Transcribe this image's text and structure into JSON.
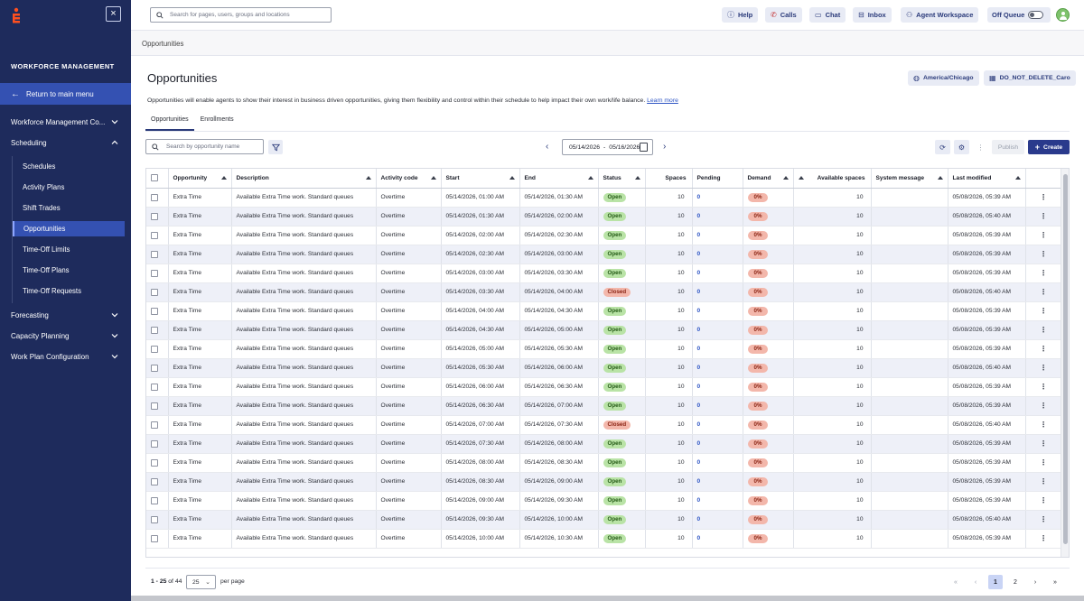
{
  "sidebar": {
    "brand_color": "#1e2b5c",
    "accent_color": "#3451b2",
    "title": "WORKFORCE MANAGEMENT",
    "return_label": "Return to main menu",
    "sections": {
      "wfm_config": "Workforce Management Co...",
      "scheduling": "Scheduling",
      "forecasting": "Forecasting",
      "capacity": "Capacity Planning",
      "work_plan": "Work Plan Configuration"
    },
    "scheduling_items": {
      "schedules": "Schedules",
      "activity_plans": "Activity Plans",
      "shift_trades": "Shift Trades",
      "opportunities": "Opportunities",
      "time_off_limits": "Time-Off Limits",
      "time_off_plans": "Time-Off Plans",
      "time_off_requests": "Time-Off Requests"
    }
  },
  "topbar": {
    "search_placeholder": "Search for pages, users, groups and locations",
    "help": "Help",
    "calls": "Calls",
    "chat": "Chat",
    "inbox": "Inbox",
    "agent_workspace": "Agent Workspace",
    "off_queue": "Off Queue"
  },
  "breadcrumb": "Opportunities",
  "page": {
    "title": "Opportunities",
    "timezone": "America/Chicago",
    "business_unit": "DO_NOT_DELETE_Caro",
    "description": "Opportunities will enable agents to show their interest in business driven opportunities, giving them flexibility and control within their schedule to help impact their own work/life balance.",
    "learn_more": "Learn more",
    "tabs": {
      "opportunities": "Opportunities",
      "enrollments": "Enrollments"
    },
    "search_placeholder": "Search by opportunity name",
    "date_start": "05/14/2026",
    "date_sep": "-",
    "date_end": "05/16/2026",
    "publish": "Publish",
    "create": "Create"
  },
  "table": {
    "columns": {
      "opportunity": "Opportunity",
      "description": "Description",
      "activity_code": "Activity code",
      "start": "Start",
      "end": "End",
      "status": "Status",
      "spaces": "Spaces",
      "pending": "Pending",
      "demand": "Demand",
      "available_spaces": "Available spaces",
      "system_message": "System message",
      "last_modified": "Last modified"
    },
    "rows": [
      {
        "opportunity": "Extra Time",
        "description": "Available Extra Time work. Standard queues",
        "activity": "Overtime",
        "start": "05/14/2026, 01:00 AM",
        "end": "05/14/2026, 01:30 AM",
        "status": "Open",
        "spaces": "10",
        "pending": "0",
        "demand": "0%",
        "available": "10",
        "message": "",
        "modified": "05/08/2026, 05:39 AM"
      },
      {
        "opportunity": "Extra Time",
        "description": "Available Extra Time work. Standard queues",
        "activity": "Overtime",
        "start": "05/14/2026, 01:30 AM",
        "end": "05/14/2026, 02:00 AM",
        "status": "Open",
        "spaces": "10",
        "pending": "0",
        "demand": "0%",
        "available": "10",
        "message": "",
        "modified": "05/08/2026, 05:40 AM"
      },
      {
        "opportunity": "Extra Time",
        "description": "Available Extra Time work. Standard queues",
        "activity": "Overtime",
        "start": "05/14/2026, 02:00 AM",
        "end": "05/14/2026, 02:30 AM",
        "status": "Open",
        "spaces": "10",
        "pending": "0",
        "demand": "0%",
        "available": "10",
        "message": "",
        "modified": "05/08/2026, 05:39 AM"
      },
      {
        "opportunity": "Extra Time",
        "description": "Available Extra Time work. Standard queues",
        "activity": "Overtime",
        "start": "05/14/2026, 02:30 AM",
        "end": "05/14/2026, 03:00 AM",
        "status": "Open",
        "spaces": "10",
        "pending": "0",
        "demand": "0%",
        "available": "10",
        "message": "",
        "modified": "05/08/2026, 05:39 AM"
      },
      {
        "opportunity": "Extra Time",
        "description": "Available Extra Time work. Standard queues",
        "activity": "Overtime",
        "start": "05/14/2026, 03:00 AM",
        "end": "05/14/2026, 03:30 AM",
        "status": "Open",
        "spaces": "10",
        "pending": "0",
        "demand": "0%",
        "available": "10",
        "message": "",
        "modified": "05/08/2026, 05:39 AM"
      },
      {
        "opportunity": "Extra Time",
        "description": "Available Extra Time work. Standard queues",
        "activity": "Overtime",
        "start": "05/14/2026, 03:30 AM",
        "end": "05/14/2026, 04:00 AM",
        "status": "Closed",
        "spaces": "10",
        "pending": "0",
        "demand": "0%",
        "available": "10",
        "message": "",
        "modified": "05/08/2026, 05:40 AM"
      },
      {
        "opportunity": "Extra Time",
        "description": "Available Extra Time work. Standard queues",
        "activity": "Overtime",
        "start": "05/14/2026, 04:00 AM",
        "end": "05/14/2026, 04:30 AM",
        "status": "Open",
        "spaces": "10",
        "pending": "0",
        "demand": "0%",
        "available": "10",
        "message": "",
        "modified": "05/08/2026, 05:39 AM"
      },
      {
        "opportunity": "Extra Time",
        "description": "Available Extra Time work. Standard queues",
        "activity": "Overtime",
        "start": "05/14/2026, 04:30 AM",
        "end": "05/14/2026, 05:00 AM",
        "status": "Open",
        "spaces": "10",
        "pending": "0",
        "demand": "0%",
        "available": "10",
        "message": "",
        "modified": "05/08/2026, 05:39 AM"
      },
      {
        "opportunity": "Extra Time",
        "description": "Available Extra Time work. Standard queues",
        "activity": "Overtime",
        "start": "05/14/2026, 05:00 AM",
        "end": "05/14/2026, 05:30 AM",
        "status": "Open",
        "spaces": "10",
        "pending": "0",
        "demand": "0%",
        "available": "10",
        "message": "",
        "modified": "05/08/2026, 05:39 AM"
      },
      {
        "opportunity": "Extra Time",
        "description": "Available Extra Time work. Standard queues",
        "activity": "Overtime",
        "start": "05/14/2026, 05:30 AM",
        "end": "05/14/2026, 06:00 AM",
        "status": "Open",
        "spaces": "10",
        "pending": "0",
        "demand": "0%",
        "available": "10",
        "message": "",
        "modified": "05/08/2026, 05:40 AM"
      },
      {
        "opportunity": "Extra Time",
        "description": "Available Extra Time work. Standard queues",
        "activity": "Overtime",
        "start": "05/14/2026, 06:00 AM",
        "end": "05/14/2026, 06:30 AM",
        "status": "Open",
        "spaces": "10",
        "pending": "0",
        "demand": "0%",
        "available": "10",
        "message": "",
        "modified": "05/08/2026, 05:39 AM"
      },
      {
        "opportunity": "Extra Time",
        "description": "Available Extra Time work. Standard queues",
        "activity": "Overtime",
        "start": "05/14/2026, 06:30 AM",
        "end": "05/14/2026, 07:00 AM",
        "status": "Open",
        "spaces": "10",
        "pending": "0",
        "demand": "0%",
        "available": "10",
        "message": "",
        "modified": "05/08/2026, 05:39 AM"
      },
      {
        "opportunity": "Extra Time",
        "description": "Available Extra Time work. Standard queues",
        "activity": "Overtime",
        "start": "05/14/2026, 07:00 AM",
        "end": "05/14/2026, 07:30 AM",
        "status": "Closed",
        "spaces": "10",
        "pending": "0",
        "demand": "0%",
        "available": "10",
        "message": "",
        "modified": "05/08/2026, 05:40 AM"
      },
      {
        "opportunity": "Extra Time",
        "description": "Available Extra Time work. Standard queues",
        "activity": "Overtime",
        "start": "05/14/2026, 07:30 AM",
        "end": "05/14/2026, 08:00 AM",
        "status": "Open",
        "spaces": "10",
        "pending": "0",
        "demand": "0%",
        "available": "10",
        "message": "",
        "modified": "05/08/2026, 05:39 AM"
      },
      {
        "opportunity": "Extra Time",
        "description": "Available Extra Time work. Standard queues",
        "activity": "Overtime",
        "start": "05/14/2026, 08:00 AM",
        "end": "05/14/2026, 08:30 AM",
        "status": "Open",
        "spaces": "10",
        "pending": "0",
        "demand": "0%",
        "available": "10",
        "message": "",
        "modified": "05/08/2026, 05:39 AM"
      },
      {
        "opportunity": "Extra Time",
        "description": "Available Extra Time work. Standard queues",
        "activity": "Overtime",
        "start": "05/14/2026, 08:30 AM",
        "end": "05/14/2026, 09:00 AM",
        "status": "Open",
        "spaces": "10",
        "pending": "0",
        "demand": "0%",
        "available": "10",
        "message": "",
        "modified": "05/08/2026, 05:39 AM"
      },
      {
        "opportunity": "Extra Time",
        "description": "Available Extra Time work. Standard queues",
        "activity": "Overtime",
        "start": "05/14/2026, 09:00 AM",
        "end": "05/14/2026, 09:30 AM",
        "status": "Open",
        "spaces": "10",
        "pending": "0",
        "demand": "0%",
        "available": "10",
        "message": "",
        "modified": "05/08/2026, 05:39 AM"
      },
      {
        "opportunity": "Extra Time",
        "description": "Available Extra Time work. Standard queues",
        "activity": "Overtime",
        "start": "05/14/2026, 09:30 AM",
        "end": "05/14/2026, 10:00 AM",
        "status": "Open",
        "spaces": "10",
        "pending": "0",
        "demand": "0%",
        "available": "10",
        "message": "",
        "modified": "05/08/2026, 05:40 AM"
      },
      {
        "opportunity": "Extra Time",
        "description": "Available Extra Time work. Standard queues",
        "activity": "Overtime",
        "start": "05/14/2026, 10:00 AM",
        "end": "05/14/2026, 10:30 AM",
        "status": "Open",
        "spaces": "10",
        "pending": "0",
        "demand": "0%",
        "available": "10",
        "message": "",
        "modified": "05/08/2026, 05:39 AM"
      }
    ]
  },
  "pagination": {
    "range": "1 - 25",
    "of_label": "of 44",
    "per_page_value": "25",
    "per_page_label": "per page",
    "pages": [
      "1",
      "2"
    ],
    "first": "«",
    "prev": "‹",
    "next": "›",
    "last": "»"
  },
  "icons": {
    "logo": "genesys-logo-icon",
    "close": "close-icon",
    "search": "search-icon",
    "filter": "filter-icon",
    "refresh": "refresh-icon",
    "settings": "gear-icon",
    "more": "more-vertical-icon",
    "calendar": "calendar-icon"
  },
  "status_colors": {
    "open": "#b9e3a6",
    "closed": "#f3b7ab"
  }
}
